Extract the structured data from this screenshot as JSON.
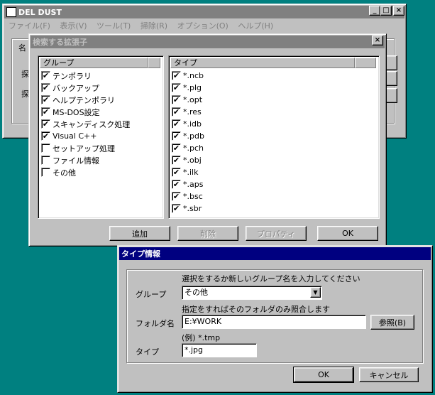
{
  "main_window": {
    "title": "DEL DUST",
    "menu": [
      "ファイル(F)",
      "表示(V)",
      "ツール(T)",
      "掃除(R)",
      "オプション(O)",
      "ヘルプ(H)"
    ],
    "partial_labels": [
      "名",
      "探",
      "探"
    ],
    "title_buttons": {
      "minimize": "_",
      "maximize": "□",
      "close": "×"
    }
  },
  "search_dialog": {
    "title": "検索する拡張子",
    "close": "×",
    "group_header": "グループ",
    "type_header": "タイプ",
    "groups": [
      {
        "label": "テンポラリ",
        "checked": true
      },
      {
        "label": "バックアップ",
        "checked": true
      },
      {
        "label": "ヘルプテンポラリ",
        "checked": true
      },
      {
        "label": "MS-DOS設定",
        "checked": true
      },
      {
        "label": "スキャンディスク処理",
        "checked": true
      },
      {
        "label": "Visual C++",
        "checked": true
      },
      {
        "label": "セットアップ処理",
        "checked": false
      },
      {
        "label": "ファイル情報",
        "checked": false
      },
      {
        "label": "その他",
        "checked": false
      }
    ],
    "types": [
      {
        "label": "*.ncb",
        "checked": true
      },
      {
        "label": "*.plg",
        "checked": true
      },
      {
        "label": "*.opt",
        "checked": true
      },
      {
        "label": "*.res",
        "checked": true
      },
      {
        "label": "*.idb",
        "checked": true
      },
      {
        "label": "*.pdb",
        "checked": true
      },
      {
        "label": "*.pch",
        "checked": true
      },
      {
        "label": "*.obj",
        "checked": true
      },
      {
        "label": "*.ilk",
        "checked": true
      },
      {
        "label": "*.aps",
        "checked": true
      },
      {
        "label": "*.bsc",
        "checked": true
      },
      {
        "label": "*.sbr",
        "checked": true
      }
    ],
    "buttons": {
      "add": "追加",
      "delete": "削除",
      "properties": "プロパティ",
      "ok": "OK"
    }
  },
  "type_dialog": {
    "title": "タイプ情報",
    "hint_group": "選択をするか新しいグループ名を入力してください",
    "group_label": "グループ",
    "group_value": "その他",
    "hint_folder": "指定をすればそのフォルダのみ照合します",
    "folder_label": "フォルダ名",
    "folder_value": "E:¥WORK",
    "browse": "参照(B)",
    "example": "(例) *.tmp",
    "type_label": "タイプ",
    "type_value": "*.jpg",
    "ok": "OK",
    "cancel": "キャンセル"
  },
  "check_mark": "✔"
}
